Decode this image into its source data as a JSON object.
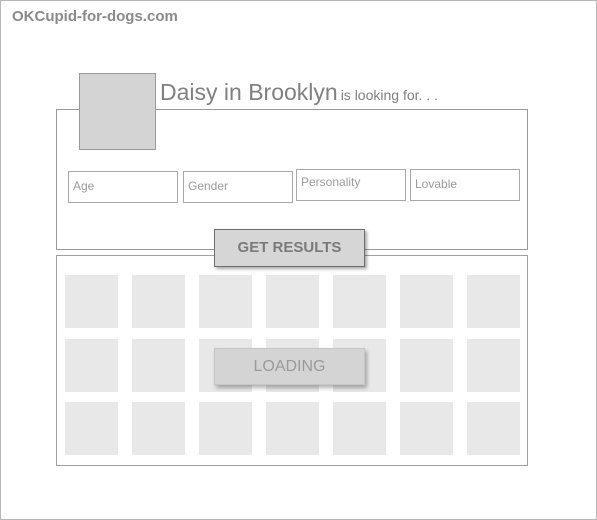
{
  "site": {
    "title": "OKCupid-for-dogs.com"
  },
  "profile": {
    "name": "Daisy in Brooklyn",
    "tagline": "is looking for. . ."
  },
  "filters": {
    "age_placeholder": "Age",
    "gender_placeholder": "Gender",
    "personality_placeholder": "Personality",
    "lovable_placeholder": "Lovable"
  },
  "actions": {
    "get_results_label": "GET RESULTS",
    "loading_label": "LOADING"
  },
  "results": {
    "rows": 3,
    "columns": 7
  },
  "colors": {
    "avatar_fill": "#d4d4d4",
    "tile_fill": "#e8e8e8",
    "button_fill": "#d6d6d6",
    "text_gray": "#808080"
  }
}
